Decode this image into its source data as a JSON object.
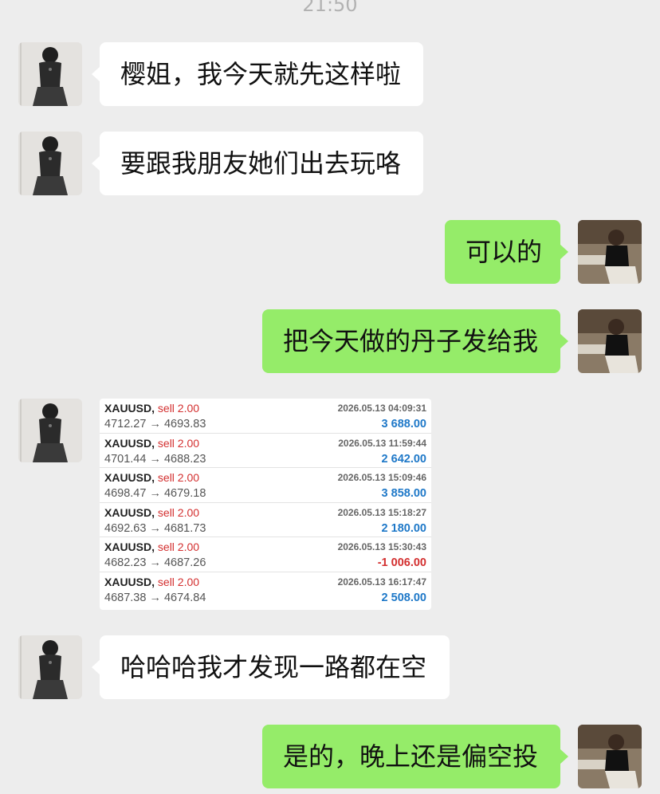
{
  "header": {
    "time": "21:50"
  },
  "messages": [
    {
      "side": "left",
      "text": "樱姐，我今天就先这样啦"
    },
    {
      "side": "left",
      "text": "要跟我朋友她们出去玩咯"
    },
    {
      "side": "right",
      "text": "可以的"
    },
    {
      "side": "right",
      "text": "把今天做的丹子发给我"
    },
    {
      "side": "left",
      "text": "哈哈哈我才发现一路都在空"
    },
    {
      "side": "right",
      "text": "是的，晚上还是偏空投"
    }
  ],
  "trades": [
    {
      "symbol": "XAUUSD,",
      "side": "sell 2.00",
      "prices": "4712.27 → 4693.83",
      "datetime": "2026.05.13 04:09:31",
      "profit": "3 688.00"
    },
    {
      "symbol": "XAUUSD,",
      "side": "sell 2.00",
      "prices": "4701.44 → 4688.23",
      "datetime": "2026.05.13 11:59:44",
      "profit": "2 642.00"
    },
    {
      "symbol": "XAUUSD,",
      "side": "sell 2.00",
      "prices": "4698.47 → 4679.18",
      "datetime": "2026.05.13 15:09:46",
      "profit": "3 858.00"
    },
    {
      "symbol": "XAUUSD,",
      "side": "sell 2.00",
      "prices": "4692.63 → 4681.73",
      "datetime": "2026.05.13 15:18:27",
      "profit": "2 180.00"
    },
    {
      "symbol": "XAUUSD,",
      "side": "sell 2.00",
      "prices": "4682.23 → 4687.26",
      "datetime": "2026.05.13 15:30:43",
      "profit": "-1 006.00"
    },
    {
      "symbol": "XAUUSD,",
      "side": "sell 2.00",
      "prices": "4687.38 → 4674.84",
      "datetime": "2026.05.13 16:17:47",
      "profit": "2 508.00"
    }
  ],
  "colors": {
    "background": "#ededed",
    "sent_bubble": "#95ec69",
    "received_bubble": "#ffffff",
    "profit_positive": "#1e78c8",
    "profit_negative": "#d32f2f"
  }
}
